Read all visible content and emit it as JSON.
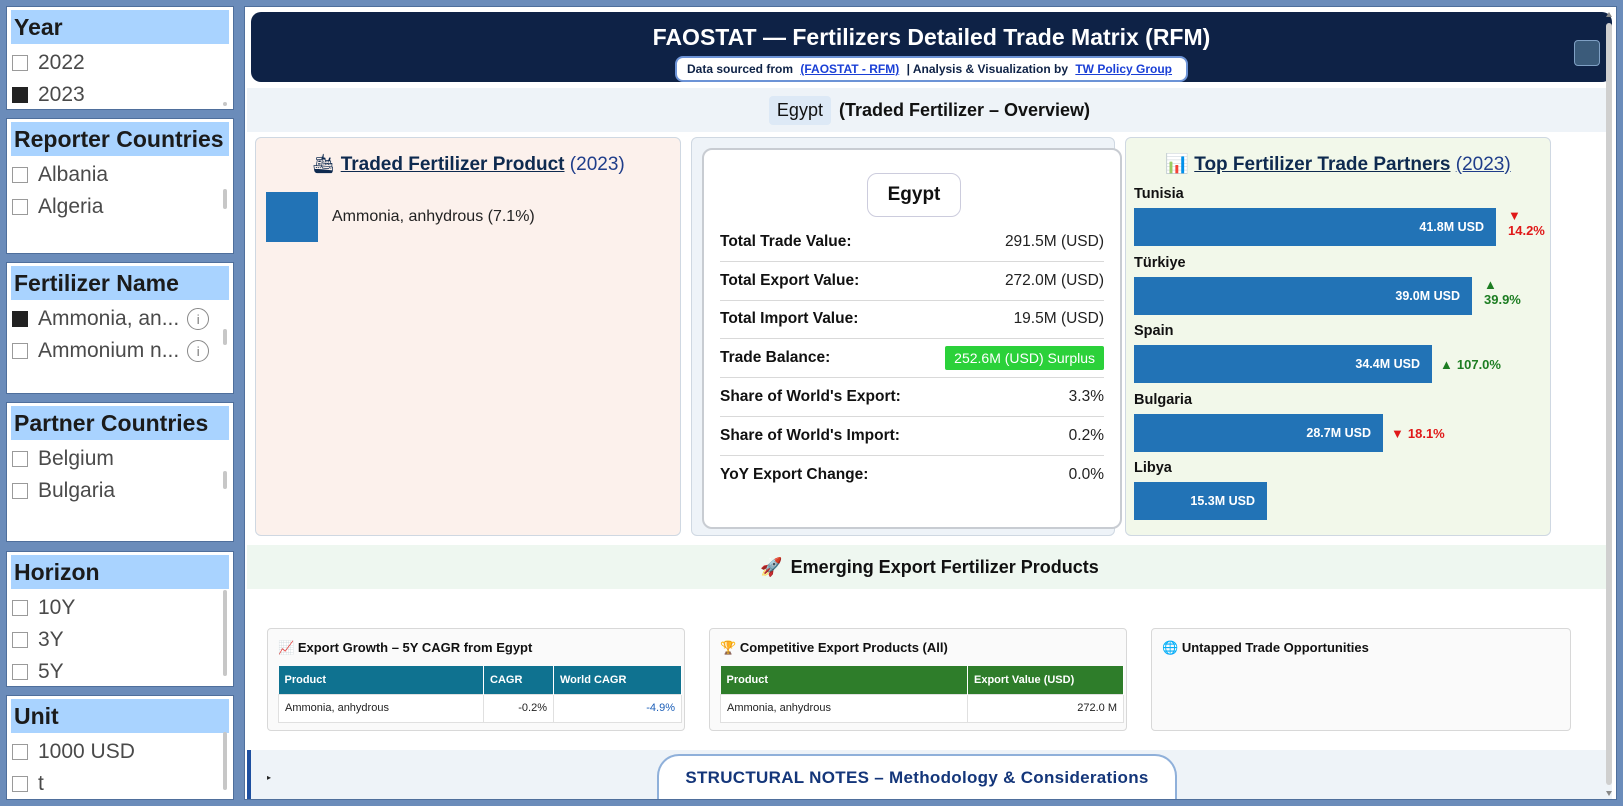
{
  "slicers": {
    "year": {
      "title": "Year",
      "items": [
        {
          "label": "2022",
          "checked": false
        },
        {
          "label": "2023",
          "checked": true
        }
      ]
    },
    "reporter": {
      "title": "Reporter Countries",
      "items": [
        {
          "label": "Albania",
          "checked": false
        },
        {
          "label": "Algeria",
          "checked": false
        }
      ]
    },
    "fertilizer": {
      "title": "Fertilizer Name",
      "items": [
        {
          "label": "Ammonia, an...",
          "checked": true
        },
        {
          "label": "Ammonium n...",
          "checked": false
        }
      ]
    },
    "partner": {
      "title": "Partner Countries",
      "items": [
        {
          "label": "Belgium",
          "checked": false
        },
        {
          "label": "Bulgaria",
          "checked": false
        }
      ]
    },
    "horizon": {
      "title": "Horizon",
      "items": [
        {
          "label": "10Y",
          "checked": false
        },
        {
          "label": "3Y",
          "checked": false
        },
        {
          "label": "5Y",
          "checked": false
        }
      ]
    },
    "unit": {
      "title": "Unit",
      "items": [
        {
          "label": "1000 USD",
          "checked": false
        },
        {
          "label": "t",
          "checked": false
        }
      ]
    }
  },
  "banner": {
    "title": "FAOSTAT — Fertilizers Detailed Trade Matrix (RFM)",
    "credit_prefix": "Data sourced from",
    "source_link": "(FAOSTAT - RFM)",
    "credit_mid": "| Analysis & Visualization by",
    "author_link": "TW Policy Group"
  },
  "overview": {
    "country": "Egypt",
    "suffix": "(Traded Fertilizer – Overview)"
  },
  "product_card": {
    "icon": "🛳",
    "title": "Traded Fertilizer Product",
    "year": "(2023)",
    "product_label": "Ammonia, anhydrous (7.1%)",
    "swatch_color": "#2273b6",
    "share": 0.071
  },
  "summary": {
    "country": "Egypt",
    "rows": [
      {
        "key": "Total Trade Value:",
        "value": "291.5M (USD)"
      },
      {
        "key": "Total Export Value:",
        "value": "272.0M (USD)"
      },
      {
        "key": "Total Import Value:",
        "value": "19.5M (USD)"
      },
      {
        "key": "Trade Balance:",
        "value": "252.6M (USD) Surplus"
      },
      {
        "key": "Share of World's Export:",
        "value": "3.3%"
      },
      {
        "key": "Share of World's Import:",
        "value": "0.2%"
      },
      {
        "key": "YoY Export Change:",
        "value": "0.0%"
      }
    ]
  },
  "partners_card": {
    "icon": "📊",
    "title": "Top Fertilizer Trade Partners",
    "year": "(2023)",
    "bar_color": "#2273b6",
    "partners": [
      {
        "name": "Tunisia",
        "value": 41.8,
        "label": "41.8M USD",
        "change": "14.2%",
        "dir": "down"
      },
      {
        "name": "Türkiye",
        "value": 39.0,
        "label": "39.0M USD",
        "change": "39.9%",
        "dir": "up"
      },
      {
        "name": "Spain",
        "value": 34.4,
        "label": "34.4M USD",
        "change": "107.0%",
        "dir": "up"
      },
      {
        "name": "Bulgaria",
        "value": 28.7,
        "label": "28.7M USD",
        "change": "18.1%",
        "dir": "down"
      },
      {
        "name": "Libya",
        "value": 15.3,
        "label": "15.3M USD",
        "change": "",
        "dir": ""
      }
    ]
  },
  "emerging": {
    "icon": "🚀",
    "title": "Emerging Export Fertilizer Products",
    "growth": {
      "icon": "📈",
      "title": "Export Growth – 5Y CAGR from Egypt",
      "header_color": "#0f7290",
      "columns": [
        "Product",
        "CAGR",
        "World CAGR"
      ],
      "rows": [
        [
          "Ammonia, anhydrous",
          "-0.2%",
          "-4.9%"
        ]
      ]
    },
    "competitive": {
      "icon": "🏆",
      "title": "Competitive Export Products (All)",
      "header_color": "#2e7d2a",
      "columns": [
        "Product",
        "Export Value (USD)"
      ],
      "rows": [
        [
          "Ammonia, anhydrous",
          "272.0 M"
        ]
      ]
    },
    "untapped": {
      "icon": "🌐",
      "title": "Untapped Trade Opportunities"
    }
  },
  "notes": {
    "title": "STRUCTURAL NOTES – Methodology & Considerations",
    "toggle": "▸"
  }
}
